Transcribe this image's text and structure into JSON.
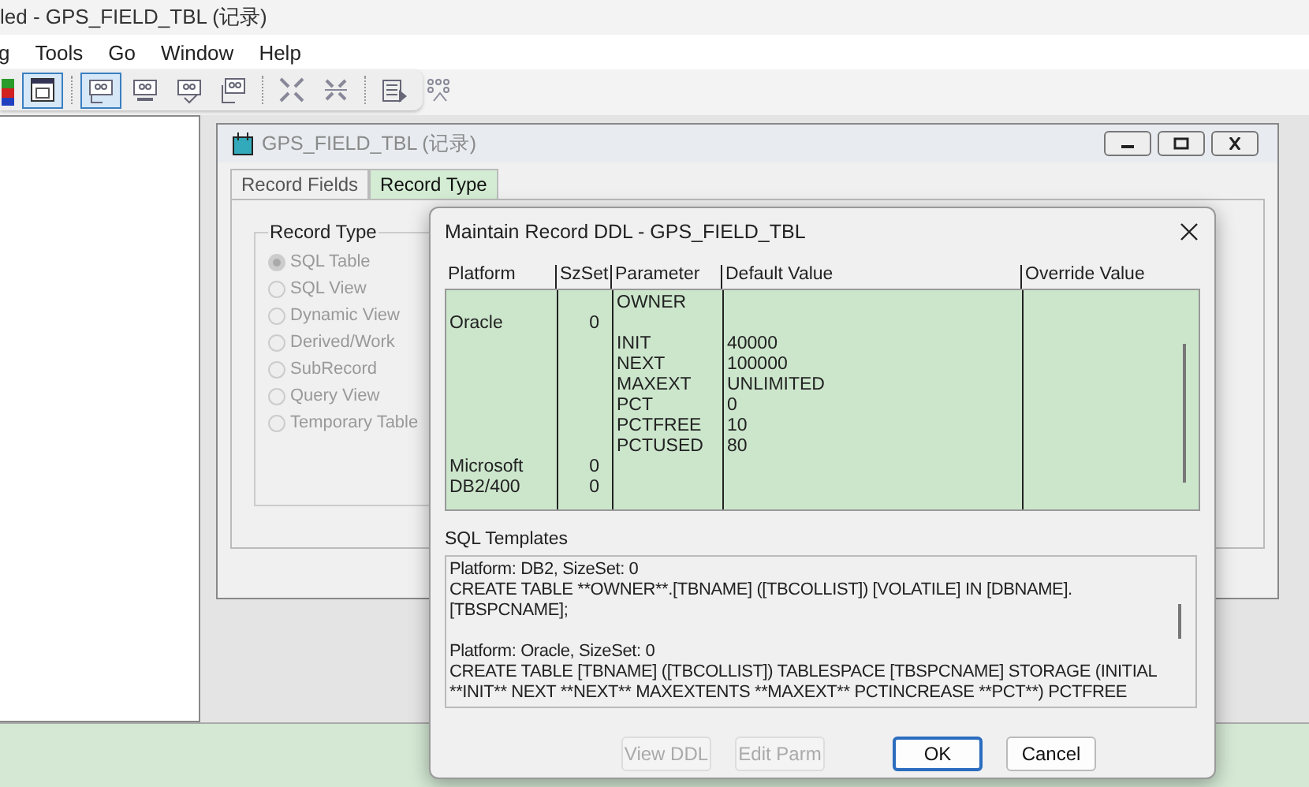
{
  "app_window": {
    "title": "led - GPS_FIELD_TBL (记录)"
  },
  "menu": [
    "g",
    "Tools",
    "Go",
    "Window",
    "Help"
  ],
  "toolbar": [
    {
      "selected": false
    },
    {
      "selected": true
    },
    {
      "selected": true
    },
    {
      "selected": false
    },
    {
      "selected": false
    },
    {
      "selected": false
    },
    {
      "selected": false
    },
    {
      "selected": false
    },
    {
      "selected": false
    },
    {
      "selected": false
    }
  ],
  "record_window": {
    "title": "GPS_FIELD_TBL (记录)",
    "tabs": [
      {
        "label": "Record Fields",
        "selected": false
      },
      {
        "label": "Record Type",
        "selected": true
      }
    ],
    "group": {
      "label": "Record Type",
      "options": [
        {
          "label": "SQL Table",
          "selected": true,
          "disabled": true
        },
        {
          "label": "SQL View",
          "selected": false,
          "disabled": true
        },
        {
          "label": "Dynamic View",
          "selected": false,
          "disabled": true
        },
        {
          "label": "Derived/Work",
          "selected": false,
          "disabled": true
        },
        {
          "label": "SubRecord",
          "selected": false,
          "disabled": true
        },
        {
          "label": "Query View",
          "selected": false,
          "disabled": true
        },
        {
          "label": "Temporary Table",
          "selected": false,
          "disabled": true
        }
      ]
    }
  },
  "dialog": {
    "title": "Maintain Record DDL - GPS_FIELD_TBL",
    "table": {
      "columns": [
        "Platform",
        "SzSet",
        "Parameter",
        "Default Value",
        "Override Value"
      ],
      "rows": [
        {
          "parameter": "OWNER"
        },
        {
          "platform": "Oracle",
          "szset": "0"
        },
        {
          "parameter": "INIT",
          "default_value": "40000"
        },
        {
          "parameter": "NEXT",
          "default_value": "100000"
        },
        {
          "parameter": "MAXEXT",
          "default_value": "UNLIMITED"
        },
        {
          "parameter": "PCT",
          "default_value": "0"
        },
        {
          "parameter": "PCTFREE",
          "default_value": "10"
        },
        {
          "parameter": "PCTUSED",
          "default_value": "80"
        },
        {
          "platform": "Microsoft",
          "szset": "0"
        },
        {
          "platform": "DB2/400",
          "szset": "0"
        }
      ]
    },
    "sql_templates": {
      "label": "SQL Templates",
      "paragraphs": [
        {
          "lines": [
            "Platform: DB2, SizeSet: 0",
            "CREATE TABLE **OWNER**.[TBNAME] ([TBCOLLIST]) [VOLATILE] IN [DBNAME].",
            "[TBSPCNAME];"
          ]
        },
        {
          "lines": [
            "Platform: Oracle, SizeSet: 0",
            "CREATE TABLE [TBNAME] ([TBCOLLIST]) TABLESPACE [TBSPCNAME] STORAGE (INITIAL",
            "**INIT** NEXT **NEXT** MAXEXTENTS **MAXEXT** PCTINCREASE **PCT**) PCTFREE"
          ]
        }
      ]
    },
    "buttons": [
      {
        "label": "View DDL",
        "disabled": true,
        "default": false
      },
      {
        "label": "Edit Parm",
        "disabled": true,
        "default": false
      },
      {
        "label": "OK",
        "disabled": false,
        "default": true
      },
      {
        "label": "Cancel",
        "disabled": false,
        "default": false
      }
    ]
  }
}
